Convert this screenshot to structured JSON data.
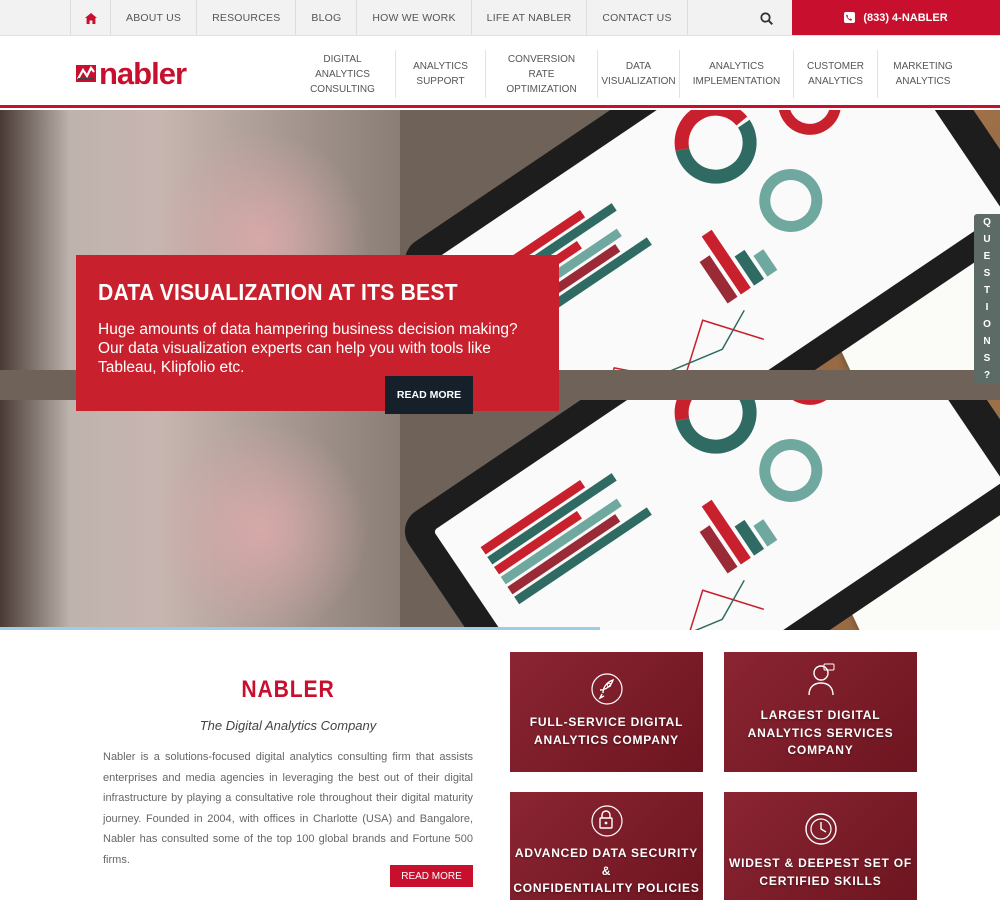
{
  "topbar": {
    "items": [
      "ABOUT US",
      "RESOURCES",
      "BLOG",
      "HOW WE WORK",
      "LIFE AT NABLER",
      "CONTACT US"
    ],
    "phone": "(833) 4-NABLER",
    "home_icon": "home-icon",
    "search_icon": "search-icon",
    "phone_icon": "phone-icon"
  },
  "header": {
    "logo_text": "nabler",
    "nav": [
      "DIGITAL ANALYTICS\nCONSULTING",
      "ANALYTICS\nSUPPORT",
      "CONVERSION RATE\nOPTIMIZATION",
      "DATA\nVISUALIZATION",
      "ANALYTICS\nIMPLEMENTATION",
      "CUSTOMER\nANALYTICS",
      "MARKETING\nANALYTICS"
    ]
  },
  "hero": {
    "title": "DATA VISUALIZATION AT ITS BEST",
    "text": "Huge amounts of data hampering business decision making? Our data visualization experts can help you with tools like Tableau, Klipfolio etc.",
    "button": "READ MORE"
  },
  "questions_tab": [
    "Q",
    "U",
    "E",
    "S",
    "T",
    "I",
    "O",
    "N",
    "S",
    "?"
  ],
  "intro": {
    "heading": "NABLER",
    "tagline": "The Digital Analytics Company",
    "body": "Nabler is a solutions-focused digital analytics consulting firm that assists enterprises and media agencies in leveraging the best out of their digital infrastructure by playing a consultative role throughout their digital maturity journey. Founded in 2004, with offices in Charlotte (USA) and Bangalore, Nabler has consulted some of the top 100 global brands and Fortune 500 firms.",
    "button": "READ MORE"
  },
  "tiles": [
    {
      "label": "FULL-SERVICE DIGITAL\nANALYTICS COMPANY",
      "icon": "rocket-icon"
    },
    {
      "label": "LARGEST DIGITAL\nANALYTICS SERVICES\nCOMPANY",
      "icon": "person-icon"
    },
    {
      "label": "ADVANCED DATA SECURITY\n&\nCONFIDENTIALITY POLICIES",
      "icon": "lock-icon"
    },
    {
      "label": "WIDEST & DEEPEST SET OF\nCERTIFIED SKILLS",
      "icon": "clock-icon"
    }
  ],
  "colors": {
    "brand_red": "#c8102e",
    "dark": "#15202b",
    "tile": "#7a1c28"
  }
}
